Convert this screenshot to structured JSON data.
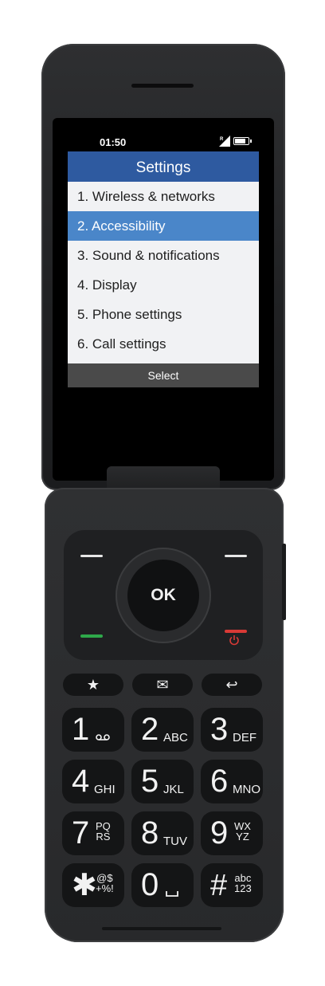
{
  "status": {
    "time": "01:50",
    "signal_label": "R",
    "battery_level_fraction": 0.85
  },
  "screen": {
    "title": "Settings",
    "menu": [
      {
        "label": "1. Wireless & networks",
        "selected": false
      },
      {
        "label": "2. Accessibility",
        "selected": true
      },
      {
        "label": "3. Sound & notifications",
        "selected": false
      },
      {
        "label": "4. Display",
        "selected": false
      },
      {
        "label": "5. Phone settings",
        "selected": false
      },
      {
        "label": "6. Call settings",
        "selected": false
      }
    ],
    "softkey_center": "Select"
  },
  "keypad": {
    "ok_label": "OK",
    "colors": {
      "call_green": "#2ea84a",
      "end_red": "#d93a36",
      "title_bar": "#2e5aa0",
      "selection": "#4a86c9"
    },
    "function_keys": [
      {
        "icon": "star-icon",
        "glyph": "★"
      },
      {
        "icon": "message-icon",
        "glyph": "✉"
      },
      {
        "icon": "back-icon",
        "glyph": "↩"
      }
    ],
    "keys": [
      {
        "num": "1",
        "letters": ""
      },
      {
        "num": "2",
        "letters": "ABC"
      },
      {
        "num": "3",
        "letters": "DEF"
      },
      {
        "num": "4",
        "letters": "GHI"
      },
      {
        "num": "5",
        "letters": "JKL"
      },
      {
        "num": "6",
        "letters": "MNO"
      },
      {
        "num": "7",
        "top": "PQ",
        "bottom": "RS"
      },
      {
        "num": "8",
        "letters": "TUV"
      },
      {
        "num": "9",
        "top": "WX",
        "bottom": "YZ"
      },
      {
        "num": "✱",
        "top": "@$",
        "bottom": "+%!"
      },
      {
        "num": "0",
        "letters": ""
      },
      {
        "num": "#",
        "top": "abc",
        "bottom": "123"
      }
    ]
  }
}
